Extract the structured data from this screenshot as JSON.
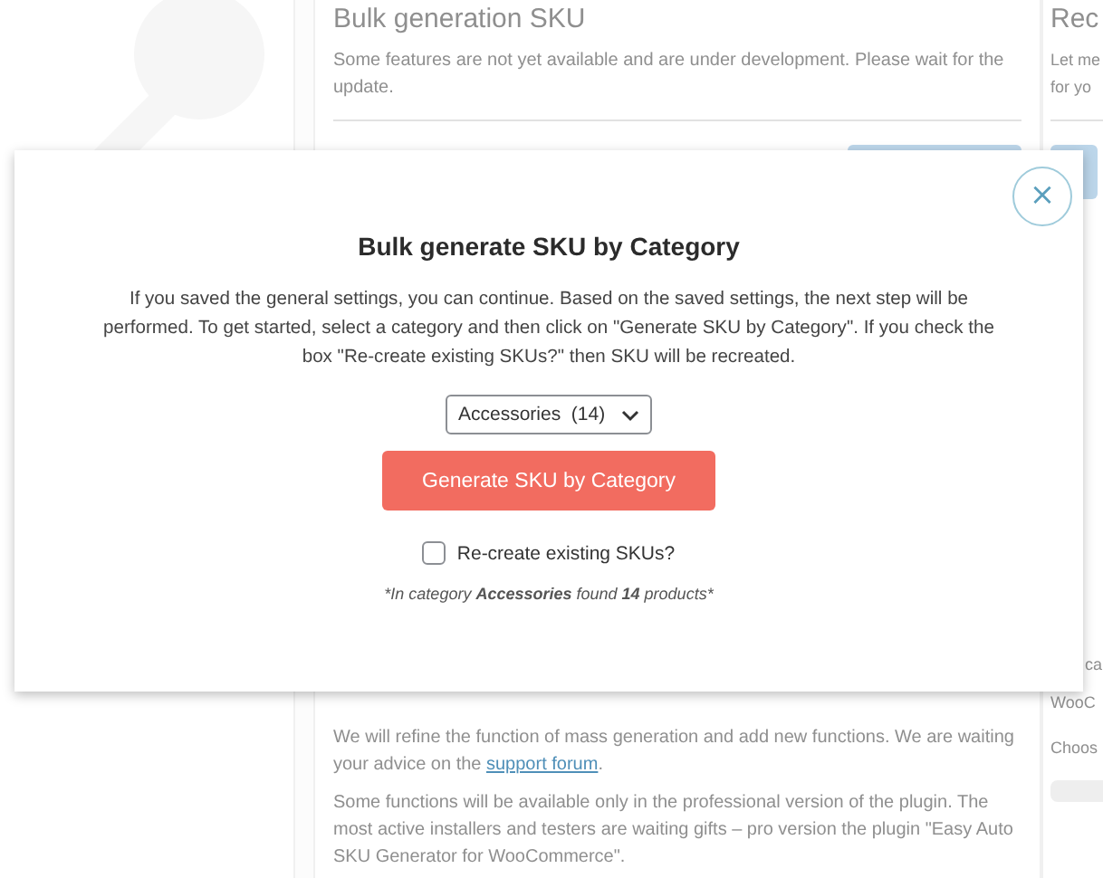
{
  "background": {
    "main_card": {
      "title": "Bulk generation SKU",
      "intro": "Some features are not yet available and are under development. Please wait for the update.",
      "paragraphs": [
        {
          "before": "We will refine the function of mass generation and add new functions. We are waiting your advice on the ",
          "link": "support forum",
          "after": "."
        },
        {
          "before": "Some functions will be available only in the professional version of the plugin. The most active installers and testers are waiting gifts – pro version the plugin \"Easy Auto SKU Generator for WooCommerce\"."
        }
      ]
    },
    "side_card": {
      "title": "Rec",
      "lines": [
        "Let me",
        "for yo"
      ],
      "lower_lines": [
        "ca",
        "WooC",
        "Choos"
      ]
    }
  },
  "modal": {
    "close": "×",
    "title": "Bulk generate SKU by Category",
    "description": "If you saved the general settings, you can continue. Based on the saved settings, the next step will be performed. To get started, select a category and then click on \"Generate SKU by Category\". If you check the box \"Re-create existing SKUs?\" then SKU will be recreated.",
    "category_select": {
      "value": "Accessories  (14)"
    },
    "generate_button": "Generate SKU by Category",
    "recreate": {
      "label": "Re-create existing SKUs?",
      "checked": false
    },
    "result": "*In category **Accessories** found **14** products*"
  }
}
